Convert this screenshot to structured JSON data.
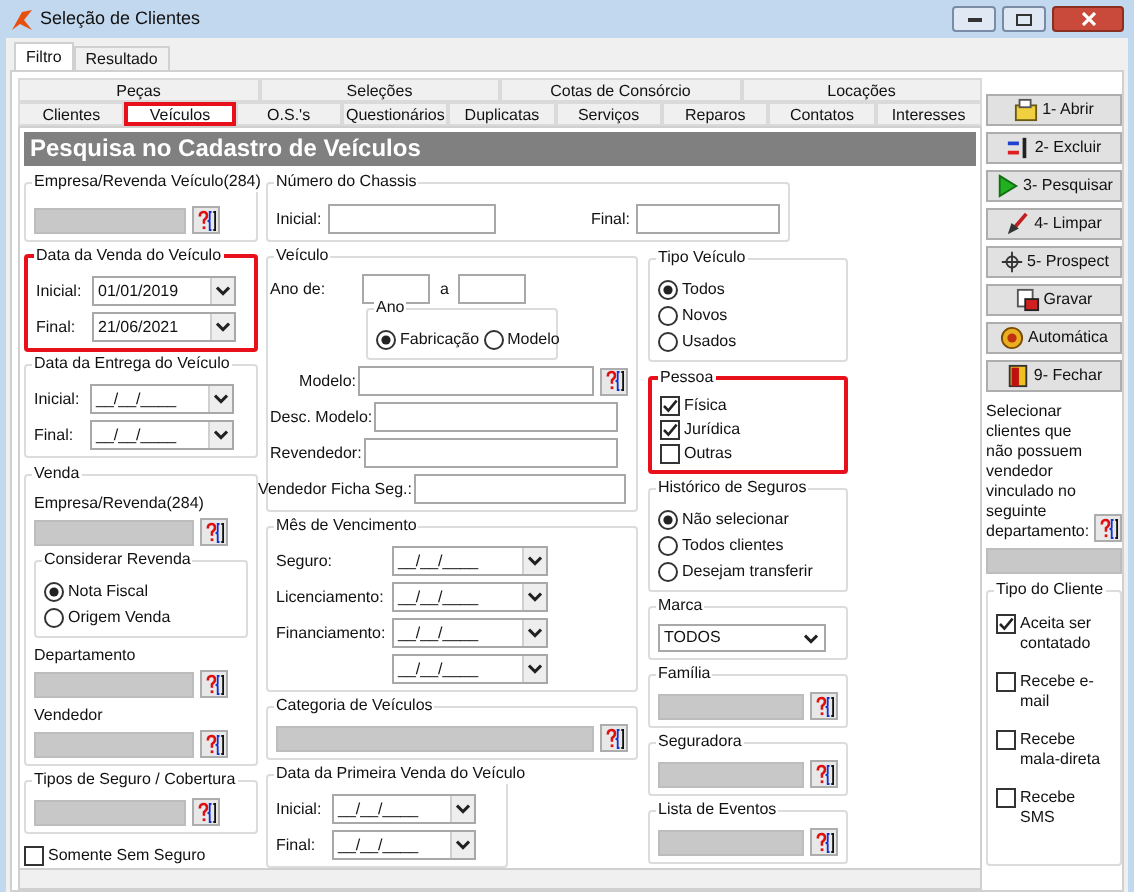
{
  "window": {
    "title": "Seleção de Clientes"
  },
  "outer_tabs": [
    {
      "label": "Filtro",
      "selected": true
    },
    {
      "label": "Resultado",
      "selected": false
    }
  ],
  "tab_rows": [
    [
      {
        "label": "Peças",
        "selected": false
      },
      {
        "label": "Seleções",
        "selected": false
      },
      {
        "label": "Cotas  de Consórcio",
        "selected": false
      },
      {
        "label": "Locações",
        "selected": false
      }
    ],
    [
      {
        "label": "Clientes",
        "selected": false
      },
      {
        "label": "Veículos",
        "selected": true,
        "highlighted": true
      },
      {
        "label": "O.S.'s",
        "selected": false
      },
      {
        "label": "Questionários",
        "selected": false
      },
      {
        "label": "Duplicatas",
        "selected": false
      },
      {
        "label": "Serviços",
        "selected": false
      },
      {
        "label": "Reparos",
        "selected": false
      },
      {
        "label": "Contatos",
        "selected": false
      },
      {
        "label": "Interesses",
        "selected": false
      }
    ]
  ],
  "header": "Pesquisa no Cadastro de Veículos",
  "empresa_revenda_veiculo": {
    "title": "Empresa/Revenda Veículo(284)"
  },
  "data_venda": {
    "title": "Data da Venda do Veículo",
    "highlighted": true,
    "fields": [
      {
        "label": "Inicial:",
        "value": "01/01/2019"
      },
      {
        "label": "Final:",
        "value": "21/06/2021"
      }
    ]
  },
  "data_entrega": {
    "title": "Data da Entrega do Veículo",
    "highlighted": false,
    "fields": [
      {
        "label": "Inicial:",
        "value": "__/__/____"
      },
      {
        "label": "Final:",
        "value": "__/__/____"
      }
    ]
  },
  "venda": {
    "title": "Venda",
    "empresa_label": "Empresa/Revenda(284)",
    "considerar": {
      "title": "Considerar Revenda",
      "options": [
        {
          "label": "Nota Fiscal",
          "selected": true
        },
        {
          "label": "Origem Venda",
          "selected": false
        }
      ]
    },
    "departamento_label": "Departamento",
    "vendedor_label": "Vendedor"
  },
  "tipos_seguro": {
    "title": "Tipos de Seguro / Cobertura"
  },
  "somente_sem_seguro": {
    "label": "Somente Sem Seguro",
    "checked": false
  },
  "chassis": {
    "title": "Número do Chassis",
    "initial_label": "Inicial:",
    "final_label": "Final:"
  },
  "veiculo": {
    "title": "Veículo",
    "ano_label": "Ano de:",
    "ano_separator": "a",
    "ano": {
      "title": "Ano",
      "options": [
        {
          "label": "Fabricação",
          "selected": true
        },
        {
          "label": "Modelo",
          "selected": false
        }
      ]
    },
    "fields": [
      {
        "label": "Modelo:",
        "lookup": true
      },
      {
        "label": "Desc. Modelo:",
        "lookup": false
      },
      {
        "label": "Revendedor:",
        "lookup": false
      },
      {
        "label": "Vendedor Ficha Seg.:",
        "lookup": false
      }
    ]
  },
  "mes_vencimento": {
    "title": "Mês de Vencimento",
    "rows": [
      {
        "label": "Seguro:",
        "value": "__/__/____"
      },
      {
        "label": "Licenciamento:",
        "value": "__/__/____"
      },
      {
        "label": "Financiamento:",
        "value": "__/__/____"
      },
      {
        "value": "__/__/____"
      }
    ]
  },
  "categoria": {
    "title": "Categoria de Veículos"
  },
  "primeira_venda": {
    "title": "Data da Primeira Venda do Veículo",
    "fields": [
      {
        "label": "Inicial:",
        "value": "__/__/____"
      },
      {
        "label": "Final:",
        "value": "__/__/____"
      }
    ]
  },
  "tipo_veiculo": {
    "title": "Tipo Veículo",
    "options": [
      {
        "label": "Todos",
        "selected": true
      },
      {
        "label": "Novos",
        "selected": false
      },
      {
        "label": "Usados",
        "selected": false
      }
    ]
  },
  "pessoa": {
    "title": "Pessoa",
    "highlighted": true,
    "options": [
      {
        "label": "Física",
        "checked": true
      },
      {
        "label": "Jurídica",
        "checked": true
      },
      {
        "label": "Outras",
        "checked": false
      }
    ]
  },
  "historico_seguros": {
    "title": "Histórico de Seguros",
    "options": [
      {
        "label": "Não selecionar",
        "selected": true
      },
      {
        "label": "Todos clientes",
        "selected": false
      },
      {
        "label": "Desejam transferir",
        "selected": false
      }
    ]
  },
  "marca": {
    "title": "Marca",
    "value": "TODOS"
  },
  "lookups_right": [
    {
      "title": "Família"
    },
    {
      "title": "Seguradora"
    },
    {
      "title": "Lista de Eventos"
    }
  ],
  "buttons": [
    {
      "label": "1- Abrir",
      "kind": "open"
    },
    {
      "label": "2- Excluir",
      "kind": "delete"
    },
    {
      "label": "3- Pesquisar",
      "kind": "search"
    },
    {
      "label": "4- Limpar",
      "kind": "clear"
    },
    {
      "label": "5- Prospect",
      "kind": "prospect"
    },
    {
      "label": "Gravar",
      "kind": "save"
    },
    {
      "label": "Automática",
      "kind": "auto"
    },
    {
      "label": "9- Fechar",
      "kind": "close"
    }
  ],
  "sem_vendedor": {
    "text": "Selecionar clientes que não possuem vendedor vinculado no seguinte departamento:"
  },
  "tipo_cliente": {
    "title": "Tipo do Cliente",
    "options": [
      {
        "label": "Aceita ser contatado",
        "checked": true
      },
      {
        "label": "Recebe e-mail",
        "checked": false
      },
      {
        "label": "Recebe mala-direta",
        "checked": false
      },
      {
        "label": "Recebe SMS",
        "checked": false
      }
    ]
  }
}
